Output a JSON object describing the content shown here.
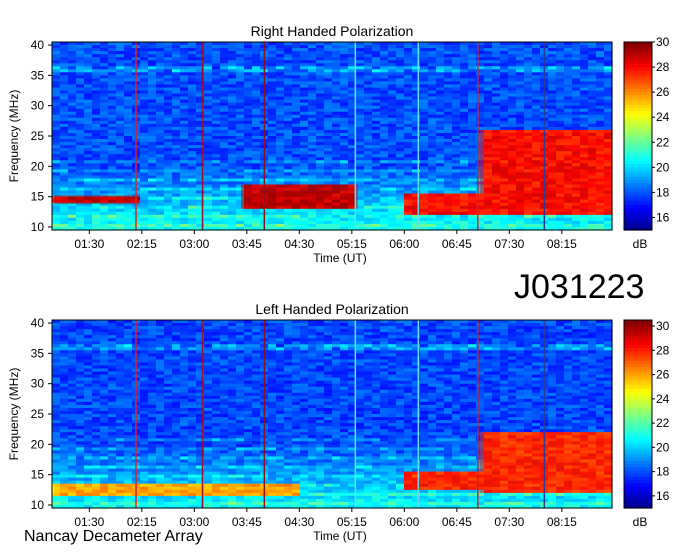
{
  "observation_id": "J031223",
  "instrument": "Nancay Decameter Array",
  "chart_data": [
    {
      "type": "heatmap",
      "title": "Right Handed Polarization",
      "xlabel": "Time (UT)",
      "ylabel": "Frequency (MHz)",
      "xticks": [
        "01:30",
        "02:15",
        "03:00",
        "03:45",
        "04:30",
        "05:15",
        "06:00",
        "06:45",
        "07:30",
        "08:15"
      ],
      "xlim": [
        "00:58",
        "08:58"
      ],
      "ylim": [
        9.5,
        40.5
      ],
      "yticks": [
        10,
        15,
        20,
        25,
        30,
        35,
        40
      ],
      "colorbar": {
        "label": "dB",
        "range": [
          15,
          30
        ],
        "ticks": [
          16,
          18,
          20,
          22,
          24,
          26,
          28,
          30
        ]
      },
      "vertical_lines": [
        {
          "time": "02:10",
          "color": "#e02020"
        },
        {
          "time": "03:07",
          "color": "#9a1030"
        },
        {
          "time": "04:00",
          "color": "#8a1020"
        },
        {
          "time": "05:18",
          "color": "#66ddee"
        },
        {
          "time": "06:12",
          "color": "#66ddee"
        },
        {
          "time": "07:03",
          "color": "#d02020"
        },
        {
          "time": "08:00",
          "color": "#2a3a99"
        }
      ],
      "strong_bands": [
        {
          "freq": [
            13.8,
            15.2
          ],
          "from": "01:00",
          "to": "02:12",
          "level": 29
        },
        {
          "freq": [
            13.0,
            17.0
          ],
          "from": "03:40",
          "to": "05:20",
          "level": 29
        },
        {
          "freq": [
            12.0,
            15.5
          ],
          "from": "06:00",
          "to": "07:05",
          "level": 28
        },
        {
          "freq": [
            12.0,
            26.0
          ],
          "from": "07:05",
          "to": "08:58",
          "level": 28
        }
      ]
    },
    {
      "type": "heatmap",
      "title": "Left Handed Polarization",
      "xlabel": "Time (UT)",
      "ylabel": "Frequency (MHz)",
      "xticks": [
        "01:30",
        "02:15",
        "03:00",
        "03:45",
        "04:30",
        "05:15",
        "06:00",
        "06:45",
        "07:30",
        "08:15"
      ],
      "xlim": [
        "00:58",
        "08:58"
      ],
      "ylim": [
        9.5,
        40.5
      ],
      "yticks": [
        10,
        15,
        20,
        25,
        30,
        35,
        40
      ],
      "colorbar": {
        "label": "dB",
        "range": [
          15,
          30.5
        ],
        "ticks": [
          16,
          18,
          20,
          22,
          24,
          26,
          28,
          30
        ]
      },
      "vertical_lines": [
        {
          "time": "02:10",
          "color": "#e02020"
        },
        {
          "time": "03:07",
          "color": "#9a1030"
        },
        {
          "time": "04:00",
          "color": "#8a1020"
        },
        {
          "time": "05:18",
          "color": "#66ddee"
        },
        {
          "time": "06:12",
          "color": "#66ddee"
        },
        {
          "time": "07:03",
          "color": "#d02020"
        },
        {
          "time": "08:00",
          "color": "#2a3a99"
        }
      ],
      "strong_bands": [
        {
          "freq": [
            11.5,
            13.5
          ],
          "from": "01:00",
          "to": "04:30",
          "level": 26
        },
        {
          "freq": [
            12.5,
            15.5
          ],
          "from": "06:00",
          "to": "07:05",
          "level": 28
        },
        {
          "freq": [
            12.0,
            22.0
          ],
          "from": "07:05",
          "to": "08:58",
          "level": 28
        }
      ]
    }
  ]
}
